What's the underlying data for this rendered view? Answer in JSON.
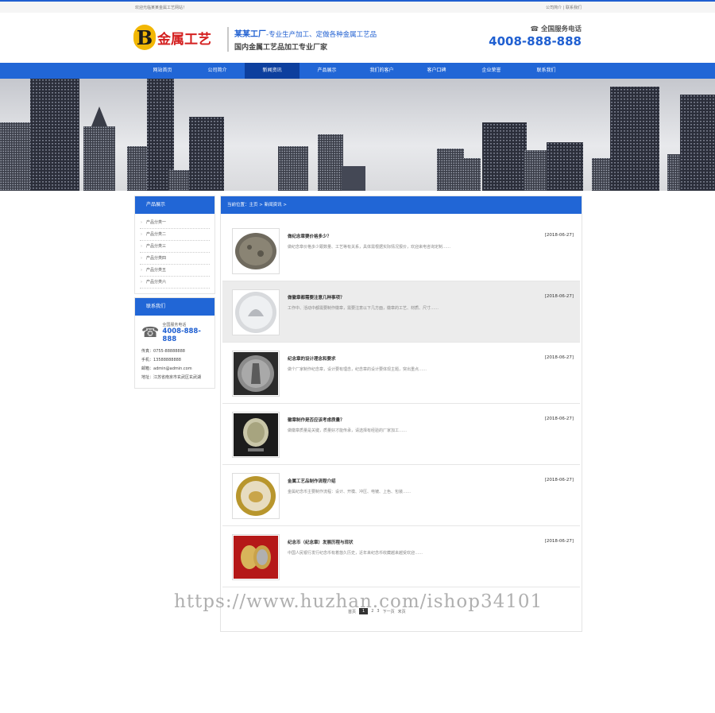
{
  "topbar": {
    "welcome": "欢迎光临某某金属工艺网站！",
    "links": "公司简介 | 联系我们"
  },
  "logo": {
    "mark": "B",
    "text": "金属工艺"
  },
  "slogan": {
    "company": "某某工厂",
    "line1": "-专业生产加工、定做各种金属工艺品",
    "line2": "国内金属工艺品加工专业厂家"
  },
  "hotline": {
    "label": "全国服务电话",
    "number": "4008-888-888"
  },
  "nav": [
    "网站首页",
    "公司简介",
    "新闻资讯",
    "产品展示",
    "我们的客户",
    "客户口碑",
    "企业荣誉",
    "联系我们"
  ],
  "sidebar": {
    "products_title": "产品展示",
    "products": [
      "产品分类一",
      "产品分类二",
      "产品分类三",
      "产品分类四",
      "产品分类五",
      "产品分类六"
    ],
    "contact_title": "联系我们",
    "contact_label": "全国服务电话",
    "contact_number": "4008-888-888",
    "lines": [
      "传真：0755-88888888",
      "手机：13588888888",
      "邮箱：admin@admin.com",
      "地址：江苏省南京市玄武区玄武湖"
    ]
  },
  "breadcrumb": "当前位置：主页 > 新闻资讯 >",
  "news": [
    {
      "title": "做纪念章要价格多少？",
      "date": "[2018-06-27]",
      "summary": "做纪念章价格多少跟数量、工艺等有关系，具体需根据实际情况报价，欢迎来电咨询定制……"
    },
    {
      "title": "做徽章都需要注意几种事项？",
      "date": "[2018-06-27]",
      "summary": "工作中、活动中都需要制作徽章，需要注意以下几方面，徽章的工艺、材质、尺寸……"
    },
    {
      "title": "纪念章的设计理念和要求",
      "date": "[2018-06-27]",
      "summary": "做个厂家制作纪念章，设计要有理念，纪念章的设计要体现主题，突出重点……"
    },
    {
      "title": "徽章制作是否应该考虑质量？",
      "date": "[2018-06-27]",
      "summary": "做徽章质量是关键，质量好才能传承，请选择有经验的厂家加工……"
    },
    {
      "title": "金属工艺品制作流程介绍",
      "date": "[2018-06-27]",
      "summary": "金属纪念币主要制作流程：设计、开模、冲压、电镀、上色、包装……"
    },
    {
      "title": "纪念币（纪念章）发展历程与现状",
      "date": "[2018-06-27]",
      "summary": "中国人民银行发行纪念币有着悠久历史，近年来纪念币收藏越来越受欢迎……"
    }
  ],
  "pager": [
    "首页",
    "1",
    "2",
    "3",
    "下一页",
    "末页"
  ],
  "watermark": "https://www.huzhan.com/ishop34101"
}
